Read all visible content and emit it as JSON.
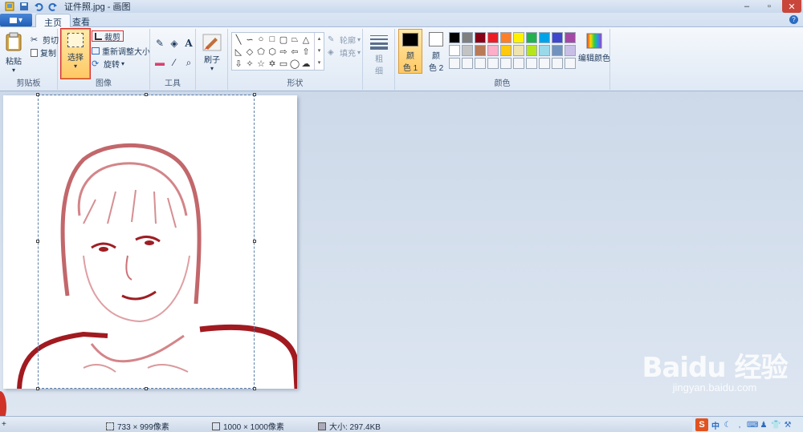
{
  "window": {
    "title": "证件照.jpg - 画图"
  },
  "tabs": {
    "file_label": "▾",
    "home": "主页",
    "view": "查看"
  },
  "ribbon": {
    "clipboard": {
      "paste": "粘贴",
      "cut": "剪切",
      "copy": "复制",
      "group": "剪贴板"
    },
    "image": {
      "select": "选择",
      "crop": "裁剪",
      "resize": "重新调整大小",
      "rotate": "旋转",
      "group": "图像"
    },
    "tools": {
      "group": "工具"
    },
    "brush": {
      "label": "刷子"
    },
    "shapes": {
      "outline": "轮廓",
      "fill": "填充",
      "group": "形状"
    },
    "size": {
      "label1": "粗",
      "label2": "细"
    },
    "colors": {
      "color1": "颜",
      "color1b": "色 1",
      "color2": "颜",
      "color2b": "色 2",
      "edit": "编辑颜色",
      "group": "颜色",
      "color1_value": "#000000",
      "color2_value": "#ffffff",
      "palette_row1": [
        "#000000",
        "#7f7f7f",
        "#880015",
        "#ed1c24",
        "#ff7f27",
        "#fff200",
        "#22b14c",
        "#00a2e8",
        "#3f48cc",
        "#a349a4"
      ],
      "palette_row2": [
        "#ffffff",
        "#c3c3c3",
        "#b97a57",
        "#ffaec9",
        "#ffc90e",
        "#efe4b0",
        "#b5e61d",
        "#99d9ea",
        "#7092be",
        "#c8bfe7"
      ]
    }
  },
  "status": {
    "cursor": "733 × 999像素",
    "selection": "1000 × 1000像素",
    "size": "大小: 297.4KB"
  },
  "watermark": {
    "main": "Baidu 经验",
    "sub": "jingyan.baidu.com"
  },
  "tray": {
    "ime": "S",
    "mode": "中"
  }
}
